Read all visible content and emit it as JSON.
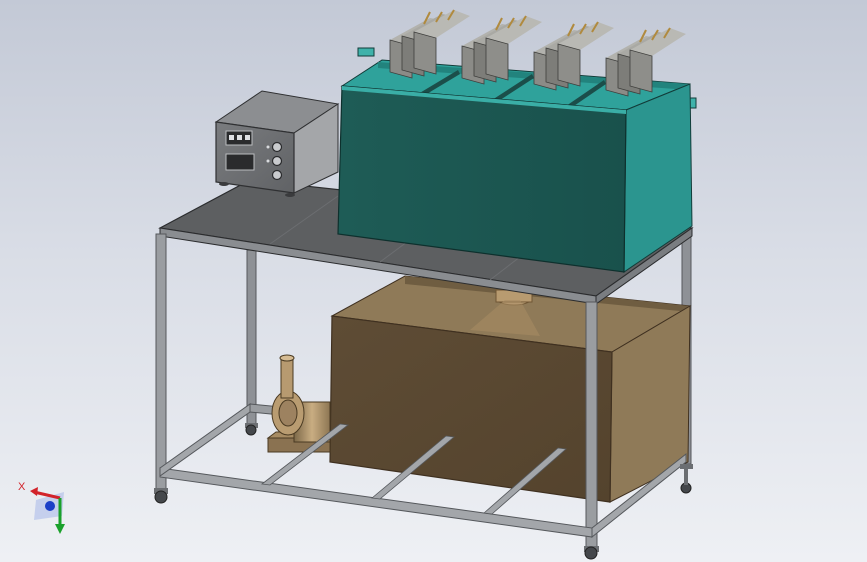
{
  "view": {
    "background_top": "#c3c9d6",
    "background_bottom": "#eef0f4"
  },
  "model": {
    "frame_color": "#8e9196",
    "tabletop_color": "#5d5f61",
    "tank_color": "#1d5a55",
    "tank_side_color": "#2b958f",
    "sump_color": "#5c4a33",
    "sump_side_color": "#8f7a58",
    "control_box_color": "#6f7174",
    "plate_color": "#8b8b87"
  },
  "triad": {
    "x_label": "X",
    "x_color": "#d2232a",
    "y_color": "#1aa12b",
    "z_color": "#1b3fc7"
  }
}
